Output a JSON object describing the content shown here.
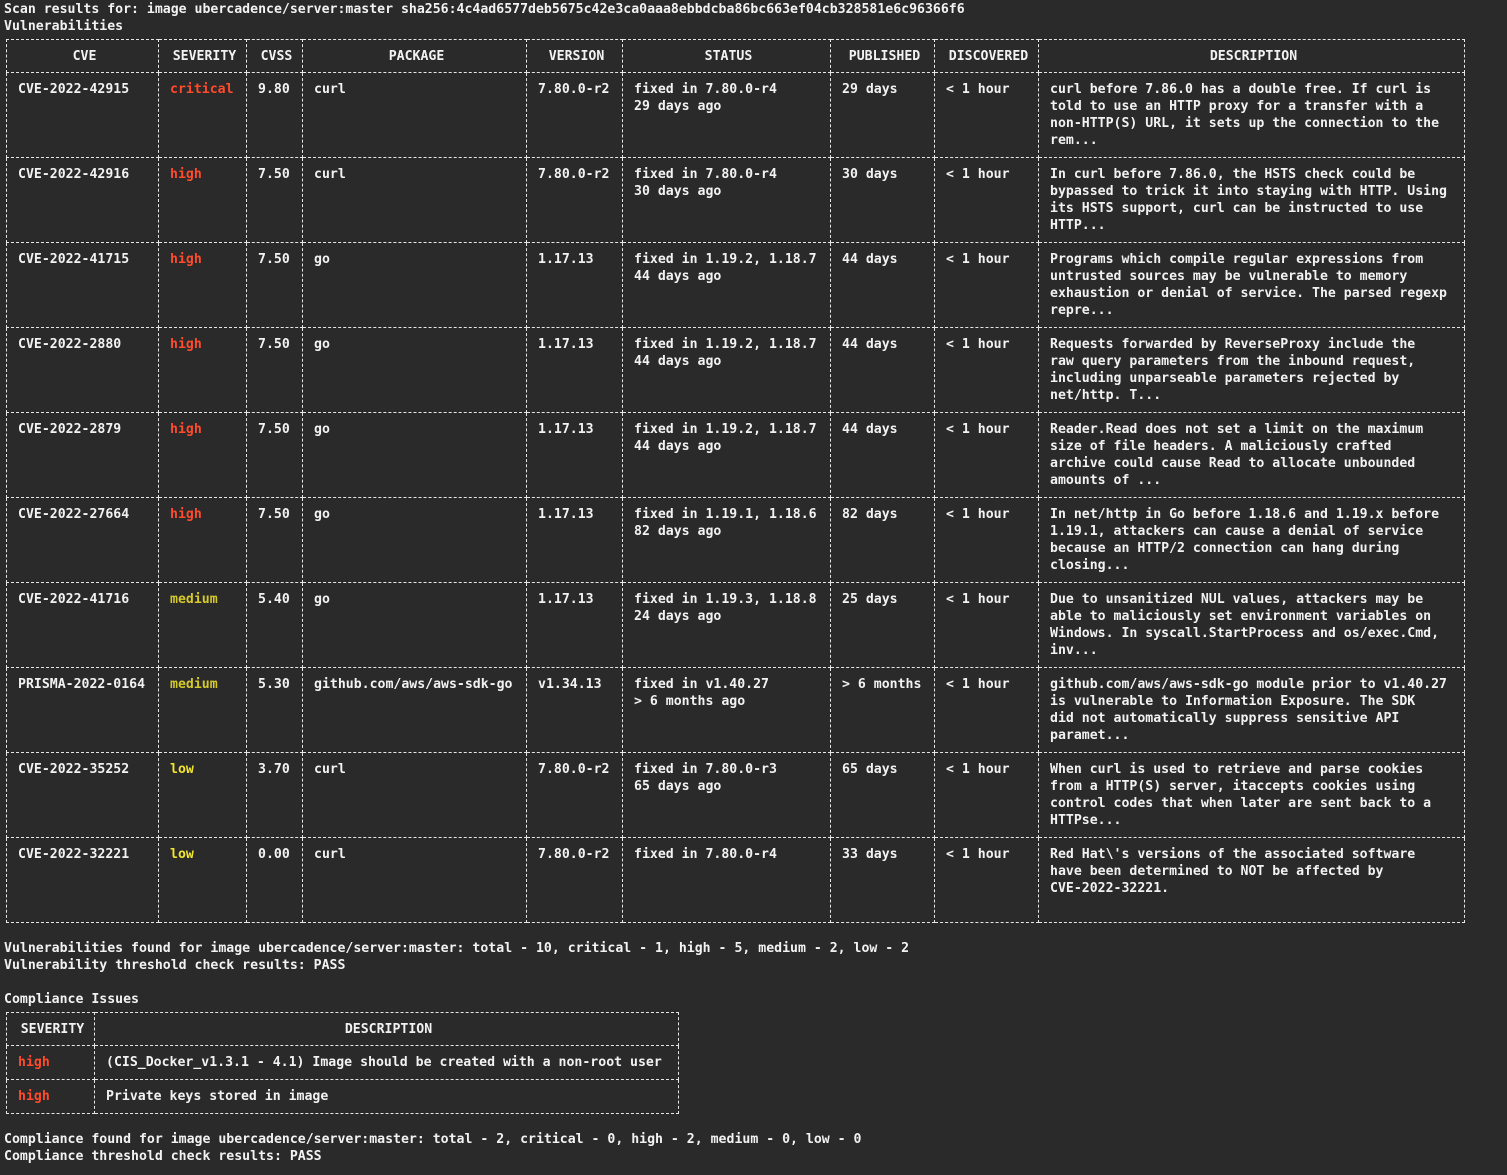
{
  "scan": {
    "title_line": "Scan results for: image ubercadence/server:master sha256:4c4ad6577deb5675c42e3ca0aaa8ebbdcba86bc663ef04cb328581e6c96366f6",
    "section_title": "Vulnerabilities"
  },
  "vuln_table": {
    "headers": [
      "CVE",
      "SEVERITY",
      "CVSS",
      "PACKAGE",
      "VERSION",
      "STATUS",
      "PUBLISHED",
      "DISCOVERED",
      "DESCRIPTION"
    ],
    "rows": [
      {
        "cve": "CVE-2022-42915",
        "severity": "critical",
        "cvss": "9.80",
        "package": "curl",
        "version": "7.80.0-r2",
        "status": "fixed in 7.80.0-r4\n29 days ago",
        "published": "29 days",
        "discovered": "< 1 hour",
        "description": "curl before 7.86.0 has a double free. If curl is\ntold to use an HTTP proxy for a transfer with a\nnon-HTTP(S) URL, it sets up the connection to the\nrem..."
      },
      {
        "cve": "CVE-2022-42916",
        "severity": "high",
        "cvss": "7.50",
        "package": "curl",
        "version": "7.80.0-r2",
        "status": "fixed in 7.80.0-r4\n30 days ago",
        "published": "30 days",
        "discovered": "< 1 hour",
        "description": "In curl before 7.86.0, the HSTS check could be\nbypassed to trick it into staying with HTTP. Using\nits HSTS support, curl can be instructed to use\nHTTP..."
      },
      {
        "cve": "CVE-2022-41715",
        "severity": "high",
        "cvss": "7.50",
        "package": "go",
        "version": "1.17.13",
        "status": "fixed in 1.19.2, 1.18.7\n44 days ago",
        "published": "44 days",
        "discovered": "< 1 hour",
        "description": "Programs which compile regular expressions from\nuntrusted sources may be vulnerable to memory\nexhaustion or denial of service. The parsed regexp\nrepre..."
      },
      {
        "cve": "CVE-2022-2880",
        "severity": "high",
        "cvss": "7.50",
        "package": "go",
        "version": "1.17.13",
        "status": "fixed in 1.19.2, 1.18.7\n44 days ago",
        "published": "44 days",
        "discovered": "< 1 hour",
        "description": "Requests forwarded by ReverseProxy include the\nraw query parameters from the inbound request,\nincluding unparseable parameters rejected by\nnet/http. T..."
      },
      {
        "cve": "CVE-2022-2879",
        "severity": "high",
        "cvss": "7.50",
        "package": "go",
        "version": "1.17.13",
        "status": "fixed in 1.19.2, 1.18.7\n44 days ago",
        "published": "44 days",
        "discovered": "< 1 hour",
        "description": "Reader.Read does not set a limit on the maximum\nsize of file headers. A maliciously crafted\narchive could cause Read to allocate unbounded\namounts of ..."
      },
      {
        "cve": "CVE-2022-27664",
        "severity": "high",
        "cvss": "7.50",
        "package": "go",
        "version": "1.17.13",
        "status": "fixed in 1.19.1, 1.18.6\n82 days ago",
        "published": "82 days",
        "discovered": "< 1 hour",
        "description": "In net/http in Go before 1.18.6 and 1.19.x before\n1.19.1, attackers can cause a denial of service\nbecause an HTTP/2 connection can hang during\nclosing..."
      },
      {
        "cve": "CVE-2022-41716",
        "severity": "medium",
        "cvss": "5.40",
        "package": "go",
        "version": "1.17.13",
        "status": "fixed in 1.19.3, 1.18.8\n24 days ago",
        "published": "25 days",
        "discovered": "< 1 hour",
        "description": "Due to unsanitized NUL values, attackers may be\nable to maliciously set environment variables on\nWindows. In syscall.StartProcess and os/exec.Cmd,\ninv..."
      },
      {
        "cve": "PRISMA-2022-0164",
        "severity": "medium",
        "cvss": "5.30",
        "package": "github.com/aws/aws-sdk-go",
        "version": "v1.34.13",
        "status": "fixed in v1.40.27\n> 6 months ago",
        "published": "> 6 months",
        "discovered": "< 1 hour",
        "description": "github.com/aws/aws-sdk-go module prior to v1.40.27\nis vulnerable to Information Exposure. The SDK\ndid not automatically suppress sensitive API\nparamet..."
      },
      {
        "cve": "CVE-2022-35252",
        "severity": "low",
        "cvss": "3.70",
        "package": "curl",
        "version": "7.80.0-r2",
        "status": "fixed in 7.80.0-r3\n65 days ago",
        "published": "65 days",
        "discovered": "< 1 hour",
        "description": "When curl is used to retrieve and parse cookies\nfrom a HTTP(S) server, itaccepts cookies using\ncontrol codes that when later are sent back to a\nHTTPse..."
      },
      {
        "cve": "CVE-2022-32221",
        "severity": "low",
        "cvss": "0.00",
        "package": "curl",
        "version": "7.80.0-r2",
        "status": "fixed in 7.80.0-r4",
        "published": "33 days",
        "discovered": "< 1 hour",
        "description": "Red Hat\\'s versions of the associated software\nhave been determined to NOT be affected by\nCVE-2022-32221."
      }
    ]
  },
  "vuln_summary": {
    "found_line": "Vulnerabilities found for image ubercadence/server:master: total - 10, critical - 1, high - 5, medium - 2, low - 2",
    "threshold_line": "Vulnerability threshold check results: PASS"
  },
  "compliance": {
    "section_title": "Compliance Issues",
    "headers": [
      "SEVERITY",
      "DESCRIPTION"
    ],
    "rows": [
      {
        "severity": "high",
        "description": "(CIS_Docker_v1.3.1 - 4.1) Image should be created with a non-root user"
      },
      {
        "severity": "high",
        "description": "Private keys stored in image"
      }
    ],
    "found_line": "Compliance found for image ubercadence/server:master: total - 2, critical - 0, high - 2, medium - 0, low - 0",
    "threshold_line": "Compliance threshold check results: PASS"
  },
  "colors": {
    "background": "#2a2a2a",
    "text": "#f2f2f2",
    "critical": "#ff4a2b",
    "high": "#ff4a2b",
    "medium": "#d4c82a",
    "low": "#f2e52e"
  }
}
